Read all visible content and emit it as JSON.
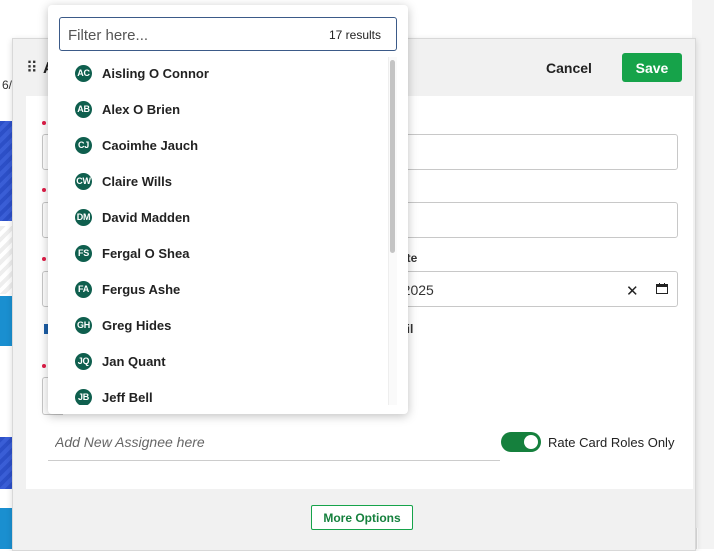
{
  "background": {
    "date_fragment": "6/"
  },
  "modal": {
    "title_fragment": "A",
    "cancel_label": "Cancel",
    "save_label": "Save",
    "date_label_fragment": "ate",
    "date_value_fragment": "-2025",
    "checkbox_label_fragment": "cil",
    "assignee_placeholder": "Add New Assignee here",
    "toggle_label": "Rate Card Roles Only",
    "toggle_on": true,
    "more_options_label": "More Options"
  },
  "dropdown": {
    "filter_placeholder": "Filter here...",
    "results_count": "17 results",
    "items": [
      {
        "initials": "AC",
        "name": "Aisling O Connor"
      },
      {
        "initials": "AB",
        "name": "Alex O Brien"
      },
      {
        "initials": "CJ",
        "name": "Caoimhe Jauch"
      },
      {
        "initials": "CW",
        "name": "Claire Wills"
      },
      {
        "initials": "DM",
        "name": "David Madden"
      },
      {
        "initials": "FS",
        "name": "Fergal O Shea"
      },
      {
        "initials": "FA",
        "name": "Fergus Ashe"
      },
      {
        "initials": "GH",
        "name": "Greg Hides"
      },
      {
        "initials": "JQ",
        "name": "Jan Quant"
      },
      {
        "initials": "JB",
        "name": "Jeff Bell"
      }
    ]
  },
  "colors": {
    "save_green": "#16a34a",
    "avatar_green": "#0f5f4e",
    "required_red": "#e11d48",
    "filter_border": "#3b5a88"
  }
}
